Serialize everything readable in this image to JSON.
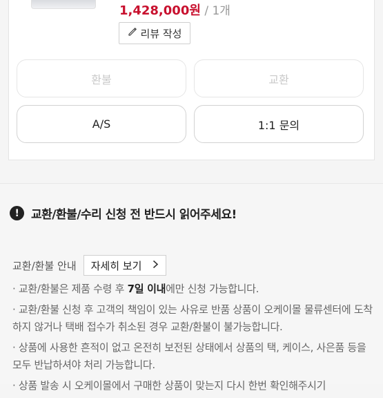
{
  "order": {
    "price": "1,428,000원",
    "qty": " / 1개",
    "review_button": "리뷰 작성"
  },
  "actions": {
    "refund": "환불",
    "exchange": "교환",
    "as": "A/S",
    "inquiry": "1:1 문의"
  },
  "notice": {
    "title": "교환/환불/수리 신청 전 반드시 읽어주세요!",
    "guide_label": "교환/환불 안내",
    "detail_button": "자세히 보기",
    "line1_pre": "· 교환/환불은 제품 수령 후 ",
    "line1_bold": "7일 이내",
    "line1_post": "에만 신청 가능합니다.",
    "line2": "· 교환/환불 신청 후 고객의 책임이 있는 사유로 반품 상품이 오케이몰 물류센터에 도착하지 않거나 택배 접수가 취소된 경우 교환/환불이 불가능합니다.",
    "line3": "· 상품에 사용한 흔적이 없고 온전히 보전된 상태에서 상품의 택, 케이스, 사은품 등을 모두 반납하셔야 처리 가능합니다.",
    "line4": "· 상품 발송 시 오케이몰에서 구매한 상품이 맞는지 다시 한번 확인해주시기"
  }
}
